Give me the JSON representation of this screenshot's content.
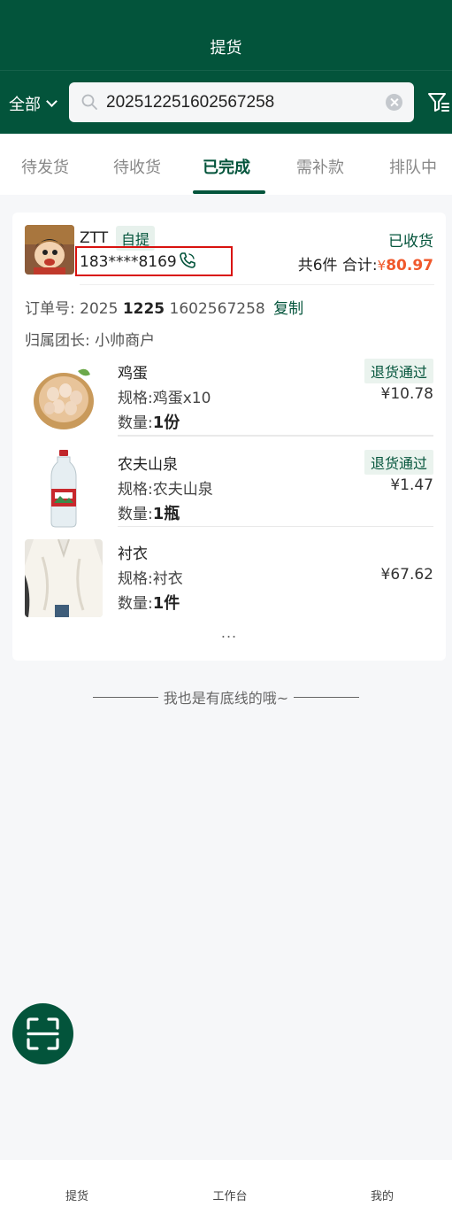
{
  "header": {
    "title": "提货"
  },
  "filter_bar": {
    "scope_label": "全部",
    "search_value": "20251225160256725 8",
    "search_placeholder": ""
  },
  "tabs": [
    {
      "label": "待发货"
    },
    {
      "label": "待收货"
    },
    {
      "label": "已完成"
    },
    {
      "label": "需补款"
    },
    {
      "label": "排队中"
    }
  ],
  "active_tab": "已完成",
  "order": {
    "customer_name": "ZTT",
    "pickup_tag": "自提",
    "phone": "183****8169",
    "status": "已收货",
    "count_text": "共6件",
    "total_label": "合计:",
    "currency": "¥",
    "total": "80.97",
    "order_no_label": "订单号:",
    "order_no_prefix": "2025",
    "order_no_bold": "1225",
    "order_no_suffix": "1602567258",
    "copy_label": "复制",
    "leader_label": "归属团长:",
    "leader_name": "小帅商户",
    "items": [
      {
        "name": "鸡蛋",
        "spec": "规格:鸡蛋x10",
        "qty_label": "数量:",
        "qty": "1份",
        "tag": "退货通过",
        "price": "¥10.78"
      },
      {
        "name": "农夫山泉",
        "spec": "规格:农夫山泉",
        "qty_label": "数量:",
        "qty": "1瓶",
        "tag": "退货通过",
        "price": "¥1.47"
      },
      {
        "name": "衬衣",
        "spec": "规格:衬衣",
        "qty_label": "数量:",
        "qty": "1件",
        "tag": "",
        "price": "¥67.62"
      }
    ],
    "more": "..."
  },
  "end_text": "我也是有底线的哦~",
  "bottom_nav": [
    {
      "label": "提货"
    },
    {
      "label": "工作台"
    },
    {
      "label": "我的"
    }
  ],
  "colors": {
    "brand": "#03543b",
    "accent": "#f0582b",
    "highlight": "#d9120f"
  }
}
